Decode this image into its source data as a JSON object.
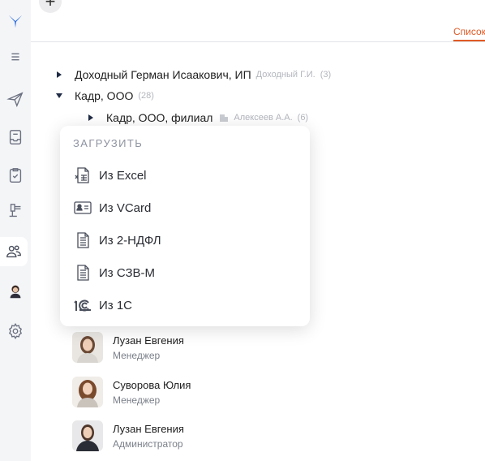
{
  "toolbar": {
    "add_label": "+"
  },
  "tabs": {
    "active_label": "Список"
  },
  "colors": {
    "accent": "#e05a26",
    "rail": "#f4f5f7",
    "logo": "#2f6fe0",
    "tree_caret": "#1f2a44"
  },
  "tree": [
    {
      "label": "Доходный Герман Исаакович, ИП",
      "muted": "Доходный Г.И.",
      "count": "(3)",
      "caret": "right"
    },
    {
      "label": "Кадр, ООО",
      "count": "(28)",
      "caret": "down"
    },
    {
      "label": "Кадр, ООО, филиал",
      "muted": "Алексеев А.А.",
      "count": "(6)",
      "caret": "right",
      "icon": "building-icon"
    }
  ],
  "popup": {
    "title": "ЗАГРУЗИТЬ",
    "items": [
      {
        "label": "Из Excel",
        "icon": "excel-file-icon"
      },
      {
        "label": "Из VCard",
        "icon": "vcard-icon"
      },
      {
        "label": "Из 2-НДФЛ",
        "icon": "document-icon"
      },
      {
        "label": "Из СЗВ-М",
        "icon": "document-icon"
      },
      {
        "label": "Из 1С",
        "icon": "1c-logo-icon"
      }
    ]
  },
  "people": [
    {
      "name": "Лузан Евгения",
      "role": "Менеджер"
    },
    {
      "name": "Суворова Юлия",
      "role": "Менеджер"
    },
    {
      "name": "Лузан Евгения",
      "role": "Администратор"
    }
  ],
  "rail_icons": [
    "logo-icon",
    "menu-icon",
    "send-icon",
    "inbox-icon",
    "clipboard-check-icon",
    "hammer-icon",
    "people-icon",
    "user-avatar",
    "gear-icon"
  ]
}
